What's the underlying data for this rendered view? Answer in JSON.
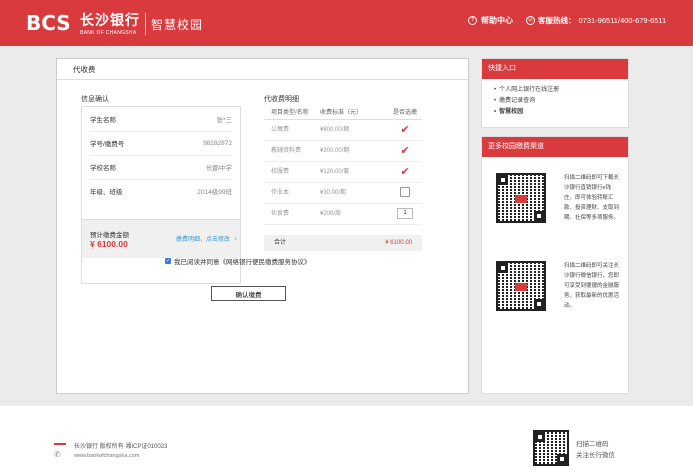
{
  "header": {
    "logo_mark": "BCS",
    "bank_name_cn": "长沙银行",
    "bank_name_en": "BANK OF CHANGSHA",
    "product": "智慧校园",
    "help_label": "帮助中心",
    "hotline_label": "客服热线：",
    "hotline_value": "0731-96511/400-679-6511"
  },
  "main": {
    "panel_title": "代收费",
    "info_title": "信息确认",
    "info_rows": [
      {
        "label": "学生名称",
        "value": "张*三"
      },
      {
        "label": "学号/缴费号",
        "value": "98282872"
      },
      {
        "label": "学校名称",
        "value": "长郡中学"
      },
      {
        "label": "年级、班级",
        "value": "2014级99班"
      }
    ],
    "estimate_label": "预计缴费金额",
    "estimate_value": "¥ 6100.00",
    "estimate_link": "缴费明细，点击修改",
    "fee_title": "代收费明细",
    "fee_headers": [
      "项目类型/名称",
      "收费标准（元）",
      "是否选缴"
    ],
    "fee_rows": [
      {
        "name": "公寓费",
        "price": "¥800.00/期",
        "state": "checked"
      },
      {
        "name": "教辅资料费",
        "price": "¥200.00/期",
        "state": "checked"
      },
      {
        "name": "校服费",
        "price": "¥120.00/套",
        "state": "checked"
      },
      {
        "name": "作业本",
        "price": "¥30.00/期",
        "state": "unchecked"
      },
      {
        "name": "伙食费",
        "price": "¥200/周",
        "state": "qty",
        "qty": "1"
      }
    ],
    "total_label": "合计",
    "total_value": "¥ 6100.00",
    "agree_text": "我已阅读并同意《网络银行便民缴费服务协议》",
    "confirm_label": "确认缴费"
  },
  "sidebar": {
    "quick_title": "快捷入口",
    "quick_items": [
      "个人网上银行在线注册",
      "缴费记录查询",
      "智慧校园"
    ],
    "more_title": "更多校园缴费渠道",
    "qr1_text": "扫描二维码即可下载长沙银行直销银行e钱庄，即可体验转账汇款、投资理财、支取到期、社保等多项服务。",
    "qr2_text": "扫描二维码即可关注长沙银行微信银行，您即可享受到便捷的金融服务，获取最新的优惠活动。"
  },
  "footer": {
    "copyright": "长沙银行  版权所有  湘ICP证010023",
    "site": "www.bankofchangsha.com",
    "scan_line1": "扫描二维码",
    "scan_line2": "关注长行微信"
  },
  "colors": {
    "brand": "#d93a3e",
    "link": "#3a9ad9"
  }
}
